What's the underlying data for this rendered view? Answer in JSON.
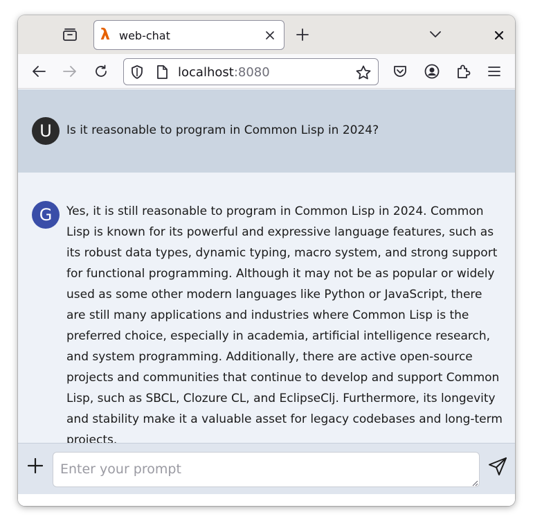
{
  "browser": {
    "tab": {
      "title": "web-chat",
      "favicon": "lambda-icon"
    },
    "url": {
      "host": "localhost",
      "port": ":8080"
    }
  },
  "chat": {
    "messages": [
      {
        "role": "user",
        "avatar_letter": "U",
        "text": "Is it reasonable to program in Common Lisp in 2024?"
      },
      {
        "role": "assistant",
        "avatar_letter": "G",
        "text": "Yes, it is still reasonable to program in Common Lisp in 2024. Common Lisp is known for its powerful and expressive language features, such as its robust data types, dynamic typing, macro system, and strong support for functional programming. Although it may not be as popular or widely used as some other modern languages like Python or JavaScript, there are still many applications and industries where Common Lisp is the preferred choice, especially in academia, artificial intelligence research, and system programming. Additionally, there are active open-source projects and communities that continue to develop and support Common Lisp, such as SBCL, Clozure CL, and EclipseClj. Furthermore, its longevity and stability make it a valuable asset for legacy codebases and long-term projects."
      }
    ],
    "composer": {
      "placeholder": "Enter your prompt",
      "value": ""
    }
  },
  "colors": {
    "user_bg": "#cbd5e1",
    "assistant_bg": "#eef2f8",
    "user_avatar": "#2b2b2b",
    "assistant_avatar": "#3a4ea8",
    "favicon": "#e66100"
  }
}
